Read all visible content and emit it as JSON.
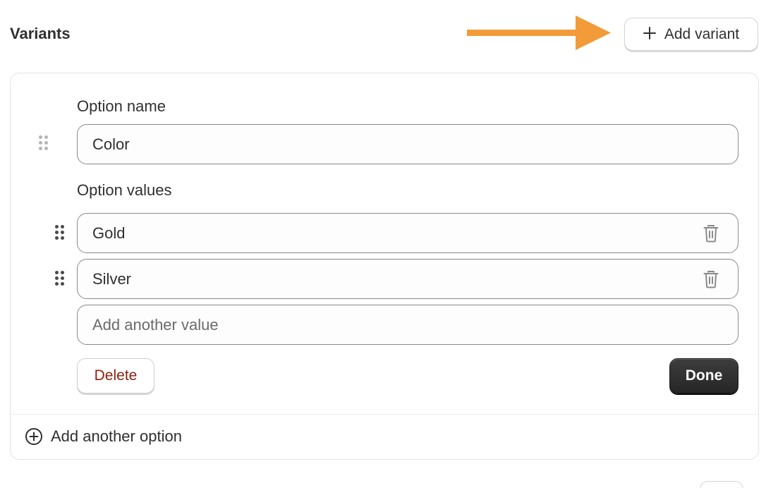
{
  "header": {
    "title": "Variants",
    "add_variant_label": "Add variant",
    "add_variant_icon": "plus-icon",
    "annotation_arrow_color": "#F29B38"
  },
  "option": {
    "name_label": "Option name",
    "name_value": "Color",
    "values_label": "Option values",
    "values": [
      {
        "value": "Gold",
        "icon": "trash-icon"
      },
      {
        "value": "Silver",
        "icon": "trash-icon"
      }
    ],
    "new_value_placeholder": "Add another value",
    "delete_label": "Delete",
    "done_label": "Done"
  },
  "footer": {
    "add_option_label": "Add another option",
    "add_option_icon": "circle-plus-icon"
  },
  "colors": {
    "delete_text": "#8E1F0B",
    "done_bg": "#303030",
    "input_border": "#8A8A8A"
  }
}
